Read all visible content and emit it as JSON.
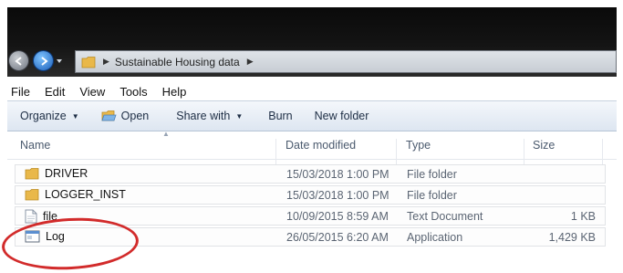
{
  "address_bar": {
    "path": [
      "Sustainable Housing data"
    ]
  },
  "menu": [
    "File",
    "Edit",
    "View",
    "Tools",
    "Help"
  ],
  "toolbar": {
    "organize": "Organize",
    "open": "Open",
    "share_with": "Share with",
    "burn": "Burn",
    "new_folder": "New folder"
  },
  "columns": {
    "name": "Name",
    "date": "Date modified",
    "type": "Type",
    "size": "Size"
  },
  "files": [
    {
      "name": "DRIVER",
      "date": "15/03/2018 1:00 PM",
      "type": "File folder",
      "size": "",
      "icon": "folder-icon"
    },
    {
      "name": "LOGGER_INST",
      "date": "15/03/2018 1:00 PM",
      "type": "File folder",
      "size": "",
      "icon": "folder-icon"
    },
    {
      "name": "file",
      "date": "10/09/2015 8:59 AM",
      "type": "Text Document",
      "size": "1 KB",
      "icon": "text-document-icon"
    },
    {
      "name": "Log",
      "date": "26/05/2015 6:20 AM",
      "type": "Application",
      "size": "1,429 KB",
      "icon": "application-icon"
    }
  ],
  "colors": {
    "highlight_circle": "#d22b2b",
    "toolbar_bg": "#dde6f1",
    "title_bar": "#0a0a0a"
  }
}
